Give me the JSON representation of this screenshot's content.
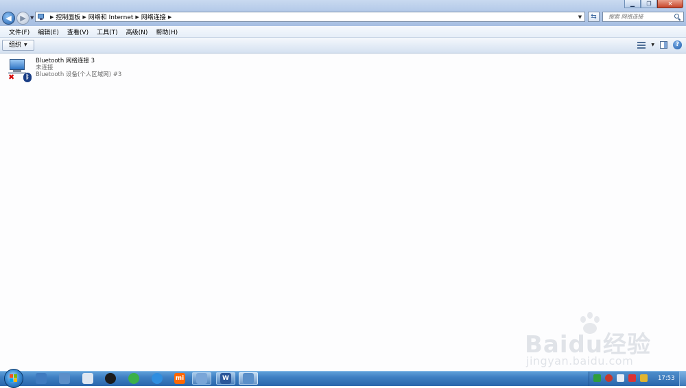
{
  "window": {
    "controls": {
      "minimize": "▁",
      "maximize": "❐",
      "close": "✕"
    }
  },
  "address": {
    "breadcrumbs": [
      "控制面板",
      "网络和 Internet",
      "网络连接"
    ]
  },
  "search": {
    "placeholder": "搜索 网络连接"
  },
  "menubar": {
    "items": [
      "文件(F)",
      "编辑(E)",
      "查看(V)",
      "工具(T)",
      "高级(N)",
      "帮助(H)"
    ]
  },
  "toolbar": {
    "organize_label": "组织",
    "help_glyph": "?"
  },
  "connection": {
    "name": "Bluetooth 网络连接 3",
    "status": "未连接",
    "device": "Bluetooth 设备(个人区域网) #3",
    "icons": [
      "network-computer-icon",
      "disconnected-x-icon",
      "bluetooth-icon"
    ]
  },
  "watermark": {
    "brand": "Baidu经验",
    "url": "jingyan.baidu.com"
  },
  "taskbar": {
    "clock": "17:53",
    "word_glyph": "W",
    "mi_glyph": "mi",
    "colors": {
      "accent": "#2a66ab",
      "word": "#2b579a",
      "mi": "#ff6700"
    }
  }
}
